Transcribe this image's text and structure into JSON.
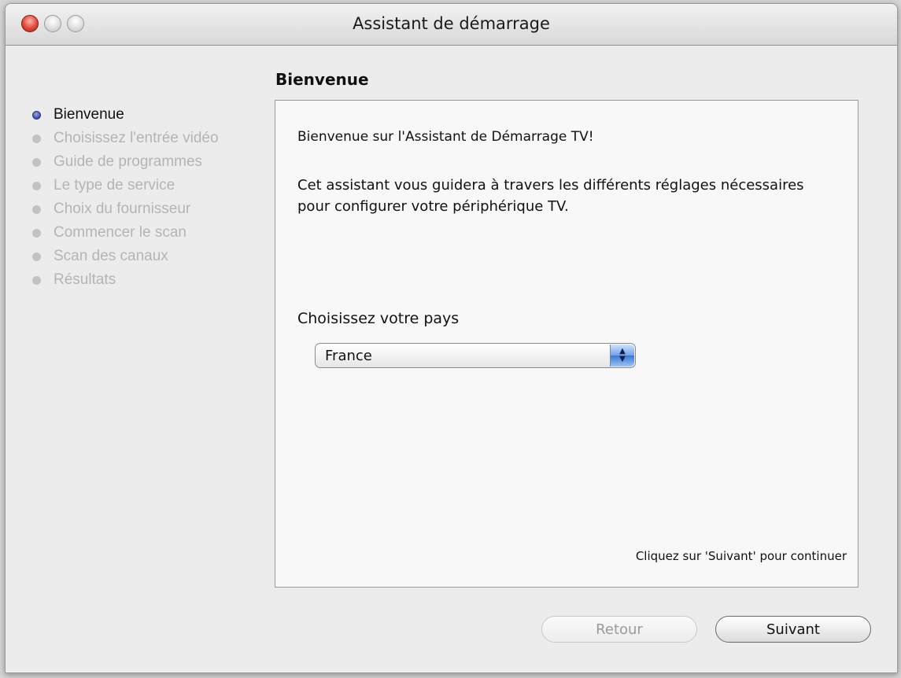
{
  "window": {
    "title": "Assistant de démarrage"
  },
  "sidebar": {
    "steps": [
      {
        "label": "Bienvenue",
        "active": true
      },
      {
        "label": "Choisissez l'entrée vidéo",
        "active": false
      },
      {
        "label": "Guide de programmes",
        "active": false
      },
      {
        "label": "Le type de service",
        "active": false
      },
      {
        "label": "Choix du fournisseur",
        "active": false
      },
      {
        "label": "Commencer le scan",
        "active": false
      },
      {
        "label": "Scan des canaux",
        "active": false
      },
      {
        "label": "Résultats",
        "active": false
      }
    ]
  },
  "main": {
    "heading": "Bienvenue",
    "welcome": "Bienvenue sur l'Assistant de Démarrage TV!",
    "description": "Cet assistant vous guidera à travers les différents réglages nécessaires pour configurer votre périphérique TV.",
    "country_label": "Choisissez votre pays",
    "country_value": "France",
    "hint": "Cliquez sur 'Suivant' pour continuer"
  },
  "buttons": {
    "back_label": "Retour",
    "back_enabled": false,
    "next_label": "Suivant"
  },
  "colors": {
    "active_step_dot": "#3a4aa8",
    "inactive_text": "#b4b4b4",
    "select_arrow": "#3c76d2"
  }
}
